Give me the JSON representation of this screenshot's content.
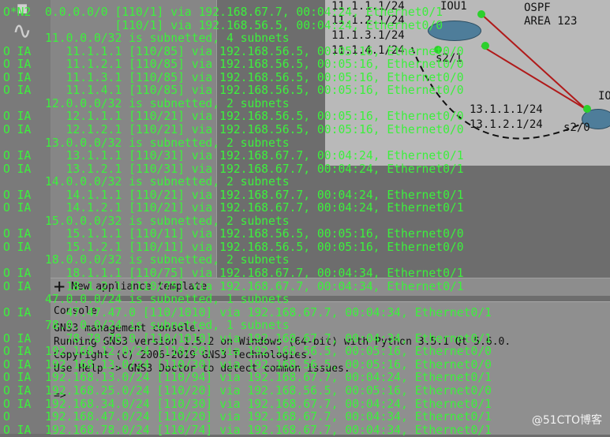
{
  "topology": {
    "top_labels": [
      "11.1.1.1/24",
      "11.1.2.1/24",
      "11.1.3.1/24",
      "11.1.4.1/24"
    ],
    "router_iou1": "IOU1",
    "ospf_label": "OSPF",
    "area_label": "AREA 123",
    "iface_s2_1": "s2/1",
    "right_labels": [
      "13.1.1.1/24",
      "13.1.2.1/24"
    ],
    "iface_s2_0": "s2/0",
    "edge_label": "IO"
  },
  "left_panel": {
    "new_template_label": "New appliance template"
  },
  "console": {
    "title": "Console",
    "lines": [
      "GNS3 management console.",
      "Running GNS3 version 1.5.2 on Windows (64-bit) with Python 3.5.1 Qt 5.6.0.",
      "Copyright (c) 2006-2019 GNS3 Technologies.",
      "Use Help -> GNS3 Doctor to detect common issues.",
      "",
      "=>"
    ]
  },
  "routes": [
    "O*N2  0.0.0.0/0 [110/1] via 192.168.67.7, 00:04:24, Ethernet0/1",
    "                [110/1] via 192.168.56.5, 00:04:24, Ethernet0/0",
    "      11.0.0.0/32 is subnetted, 4 subnets",
    "O IA     11.1.1.1 [110/85] via 192.168.56.5, 00:05:16, Ethernet0/0",
    "O IA     11.1.2.1 [110/85] via 192.168.56.5, 00:05:16, Ethernet0/0",
    "O IA     11.1.3.1 [110/85] via 192.168.56.5, 00:05:16, Ethernet0/0",
    "O IA     11.1.4.1 [110/85] via 192.168.56.5, 00:05:16, Ethernet0/0",
    "      12.0.0.0/32 is subnetted, 2 subnets",
    "O IA     12.1.1.1 [110/21] via 192.168.56.5, 00:05:16, Ethernet0/0",
    "O IA     12.1.2.1 [110/21] via 192.168.56.5, 00:05:16, Ethernet0/0",
    "      13.0.0.0/32 is subnetted, 2 subnets",
    "O IA     13.1.1.1 [110/31] via 192.168.67.7, 00:04:24, Ethernet0/1",
    "O IA     13.1.2.1 [110/31] via 192.168.67.7, 00:04:24, Ethernet0/1",
    "      14.0.0.0/32 is subnetted, 2 subnets",
    "O IA     14.1.1.1 [110/21] via 192.168.67.7, 00:04:24, Ethernet0/1",
    "O IA     14.1.2.1 [110/21] via 192.168.67.7, 00:04:24, Ethernet0/1",
    "      15.0.0.0/32 is subnetted, 2 subnets",
    "O IA     15.1.1.1 [110/11] via 192.168.56.5, 00:05:16, Ethernet0/0",
    "O IA     15.1.2.1 [110/11] via 192.168.56.5, 00:05:16, Ethernet0/0",
    "      18.0.0.0/32 is subnetted, 2 subnets",
    "O IA     18.1.1.1 [110/75] via 192.168.67.7, 00:04:34, Ethernet0/1",
    "O IA     18.1.2.1 [110/75] via 192.168.67.7, 00:04:34, Ethernet0/1",
    "      47.0.0.0/24 is subnetted, 1 subnets",
    "O IA     47.47.47.0 [110/1010] via 192.168.67.7, 00:04:34, Ethernet0/1",
    "      78.0.0.0/24 is subnetted, 1 subnets",
    "O IA     78.78.78.0 [110/1010] via 192.168.67.7, 00:04:34, Ethernet0/1",
    "O IA  192.168.12.0/24 [110/20] via 192.168.56.5, 00:05:16, Ethernet0/0",
    "O IA  192.168.13.0/24 [110/30] via 192.168.56.5, 00:05:16, Ethernet0/0",
    "O IA  192.168.13.0/24 [110/94] via 192.168.67.7, 00:04:24, Ethernet0/1",
    "O IA  192.168.25.0/24 [110/20] via 192.168.56.5, 00:05:16, Ethernet0/0",
    "O IA  192.168.34.0/24 [110/30] via 192.168.67.7, 00:04:24, Ethernet0/1",
    "O     192.168.47.0/24 [110/20] via 192.168.67.7, 00:04:34, Ethernet0/1",
    "O IA  192.168.78.0/24 [110/74] via 192.168.67.7, 00:04:34, Ethernet0/1"
  ],
  "watermark": "@51CTO博客",
  "colors": {
    "terminal_text": "#3cf03c",
    "background": "#6d6d6d"
  }
}
